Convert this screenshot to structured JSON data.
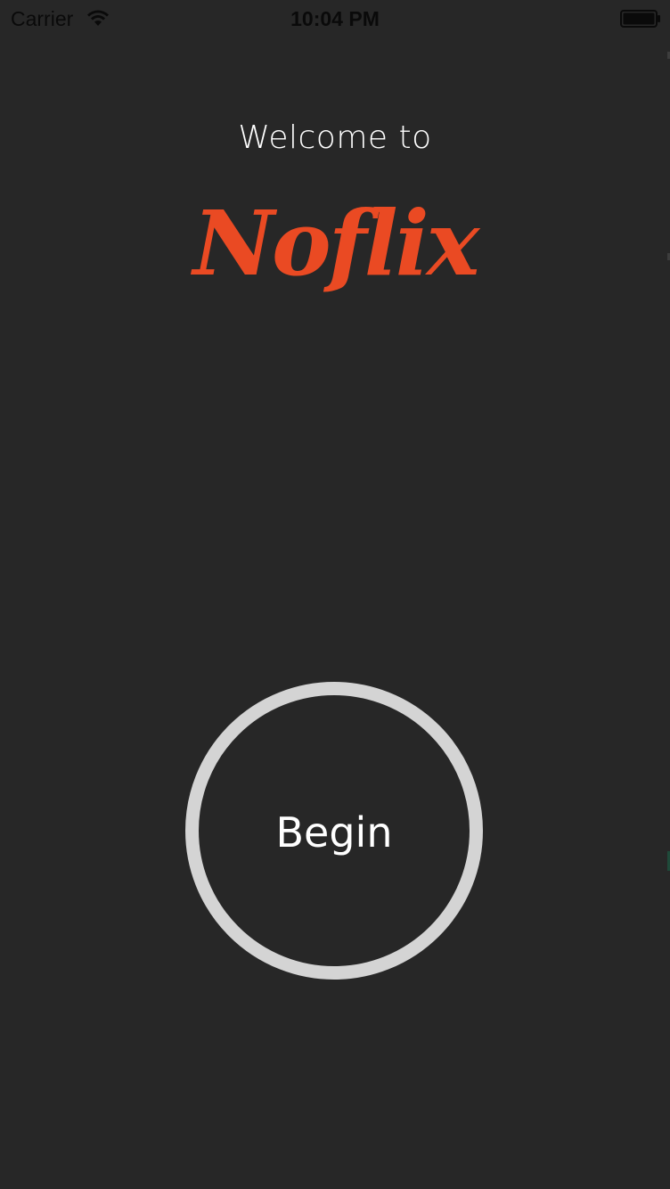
{
  "status_bar": {
    "carrier": "Carrier",
    "time": "10:04 PM",
    "wifi_icon": "wifi-icon",
    "battery_icon": "battery-icon"
  },
  "welcome": {
    "intro": "Welcome to",
    "app_name": "Noflix"
  },
  "begin_button": {
    "label": "Begin"
  },
  "colors": {
    "background": "#272727",
    "brand": "#ea4a23",
    "ring": "#d4d4d4",
    "text": "#ffffff"
  }
}
